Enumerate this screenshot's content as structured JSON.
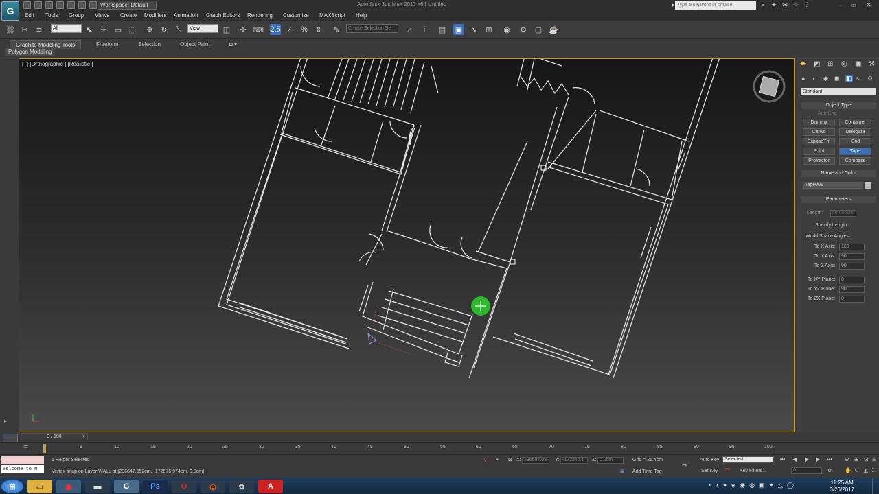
{
  "titlebar": {
    "app_logo": "G",
    "workspace": "Workspace: Default",
    "window_title": "Autodesk 3ds Max 2013 x64      Untitled",
    "search_placeholder": "Type a keyword or phrase"
  },
  "menu": [
    "Edit",
    "Tools",
    "Group",
    "Views",
    "Create",
    "Modifiers",
    "Animation",
    "Graph Editors",
    "Rendering",
    "Customize",
    "MAXScript",
    "Help"
  ],
  "toolbar": {
    "selection_filter": "All",
    "reference_coord": "View",
    "snap_label": "2.5",
    "named_selection": "Create Selection Se"
  },
  "ribbon": {
    "tabs": [
      "Graphite Modeling Tools",
      "Freeform",
      "Selection",
      "Object Paint"
    ],
    "panel": "Polygon Modeling"
  },
  "viewport": {
    "label": "[+] [Orthographic ] [Realistic ]"
  },
  "command_panel": {
    "dropdown": "Standard",
    "object_type_title": "Object Type",
    "autogrid": "AutoGrid",
    "buttons": [
      "Dummy",
      "Container",
      "Crowd",
      "Delegate",
      "ExposeTm",
      "Grid",
      "Point",
      "Tape",
      "Protractor",
      "Compass"
    ],
    "selected_button": "Tape",
    "name_color_title": "Name and Color",
    "object_name": "Tape001",
    "parameters_title": "Parameters",
    "length_label": "Length:",
    "length_value": "50.006cm",
    "specify_length": "Specify Length",
    "world_space_angles": "World Space Angles",
    "angles": [
      {
        "label": "To X Axis:",
        "value": "180"
      },
      {
        "label": "To Y Axis:",
        "value": "90"
      },
      {
        "label": "To Z Axis:",
        "value": "90"
      },
      {
        "label": "To XY Plane:",
        "value": "0"
      },
      {
        "label": "To YZ Plane:",
        "value": "90"
      },
      {
        "label": "To ZX Plane:",
        "value": "0"
      }
    ]
  },
  "timeline": {
    "slider": "0 / 100",
    "ticks": [
      "0",
      "5",
      "10",
      "15",
      "20",
      "25",
      "30",
      "35",
      "40",
      "45",
      "50",
      "55",
      "60",
      "65",
      "70",
      "75",
      "80",
      "85",
      "90",
      "95",
      "100"
    ]
  },
  "status": {
    "maxscript": "Welcome to M",
    "selected": "1 Helper Selected",
    "prompt": "Vertex snap on Layer:WALL at [296647.552cm, -172575.974cm, 0.0cm]",
    "x_label": "X:",
    "x_value": "296687.08",
    "y_label": "Y:",
    "y_value": "-172346.1",
    "z_label": "Z:",
    "z_value": "0.0cm",
    "grid": "Grid = 25.4cm",
    "add_time_tag": "Add Time Tag",
    "auto_key": "Auto Key",
    "auto_key_value": "Selected",
    "set_key": "Set Key",
    "key_filters": "Key Filters...",
    "frame": "0"
  },
  "taskbar": {
    "time": "11:25 AM",
    "date": "3/26/2017"
  }
}
